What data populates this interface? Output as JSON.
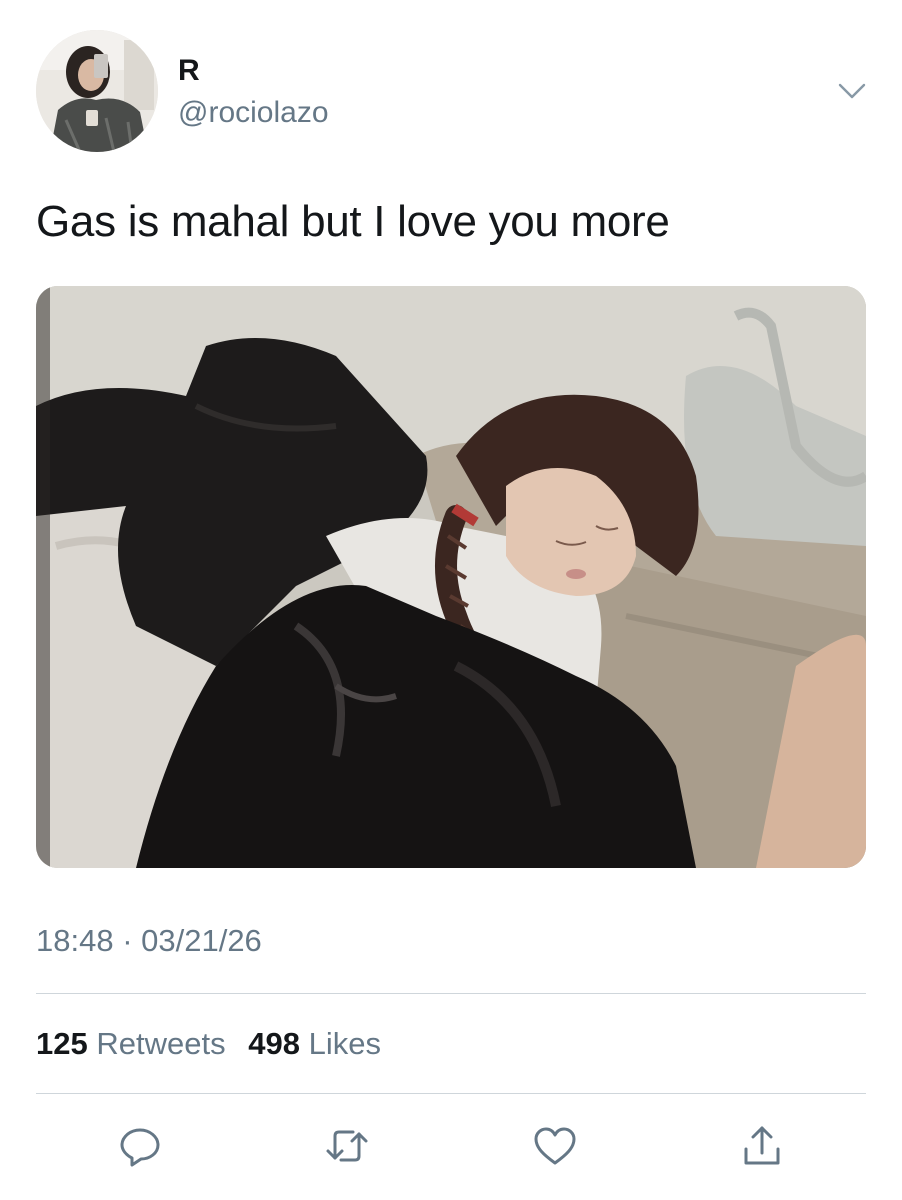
{
  "tweet": {
    "author": {
      "name": "R",
      "handle": "@rociolazo"
    },
    "text": "Gas is mahal but I love you more",
    "timestamp": "18:48 · 03/21/26",
    "stats": {
      "retweets_count": "125",
      "retweets_label": "Retweets",
      "likes_count": "498",
      "likes_label": "Likes"
    },
    "icons": {
      "menu": "chevron-down-icon",
      "reply": "reply-icon",
      "retweet": "retweet-icon",
      "like": "heart-icon",
      "share": "share-icon"
    }
  },
  "colors": {
    "text_primary": "#14171a",
    "text_secondary": "#657786",
    "divider": "#cfd6db",
    "icon": "#657786"
  }
}
